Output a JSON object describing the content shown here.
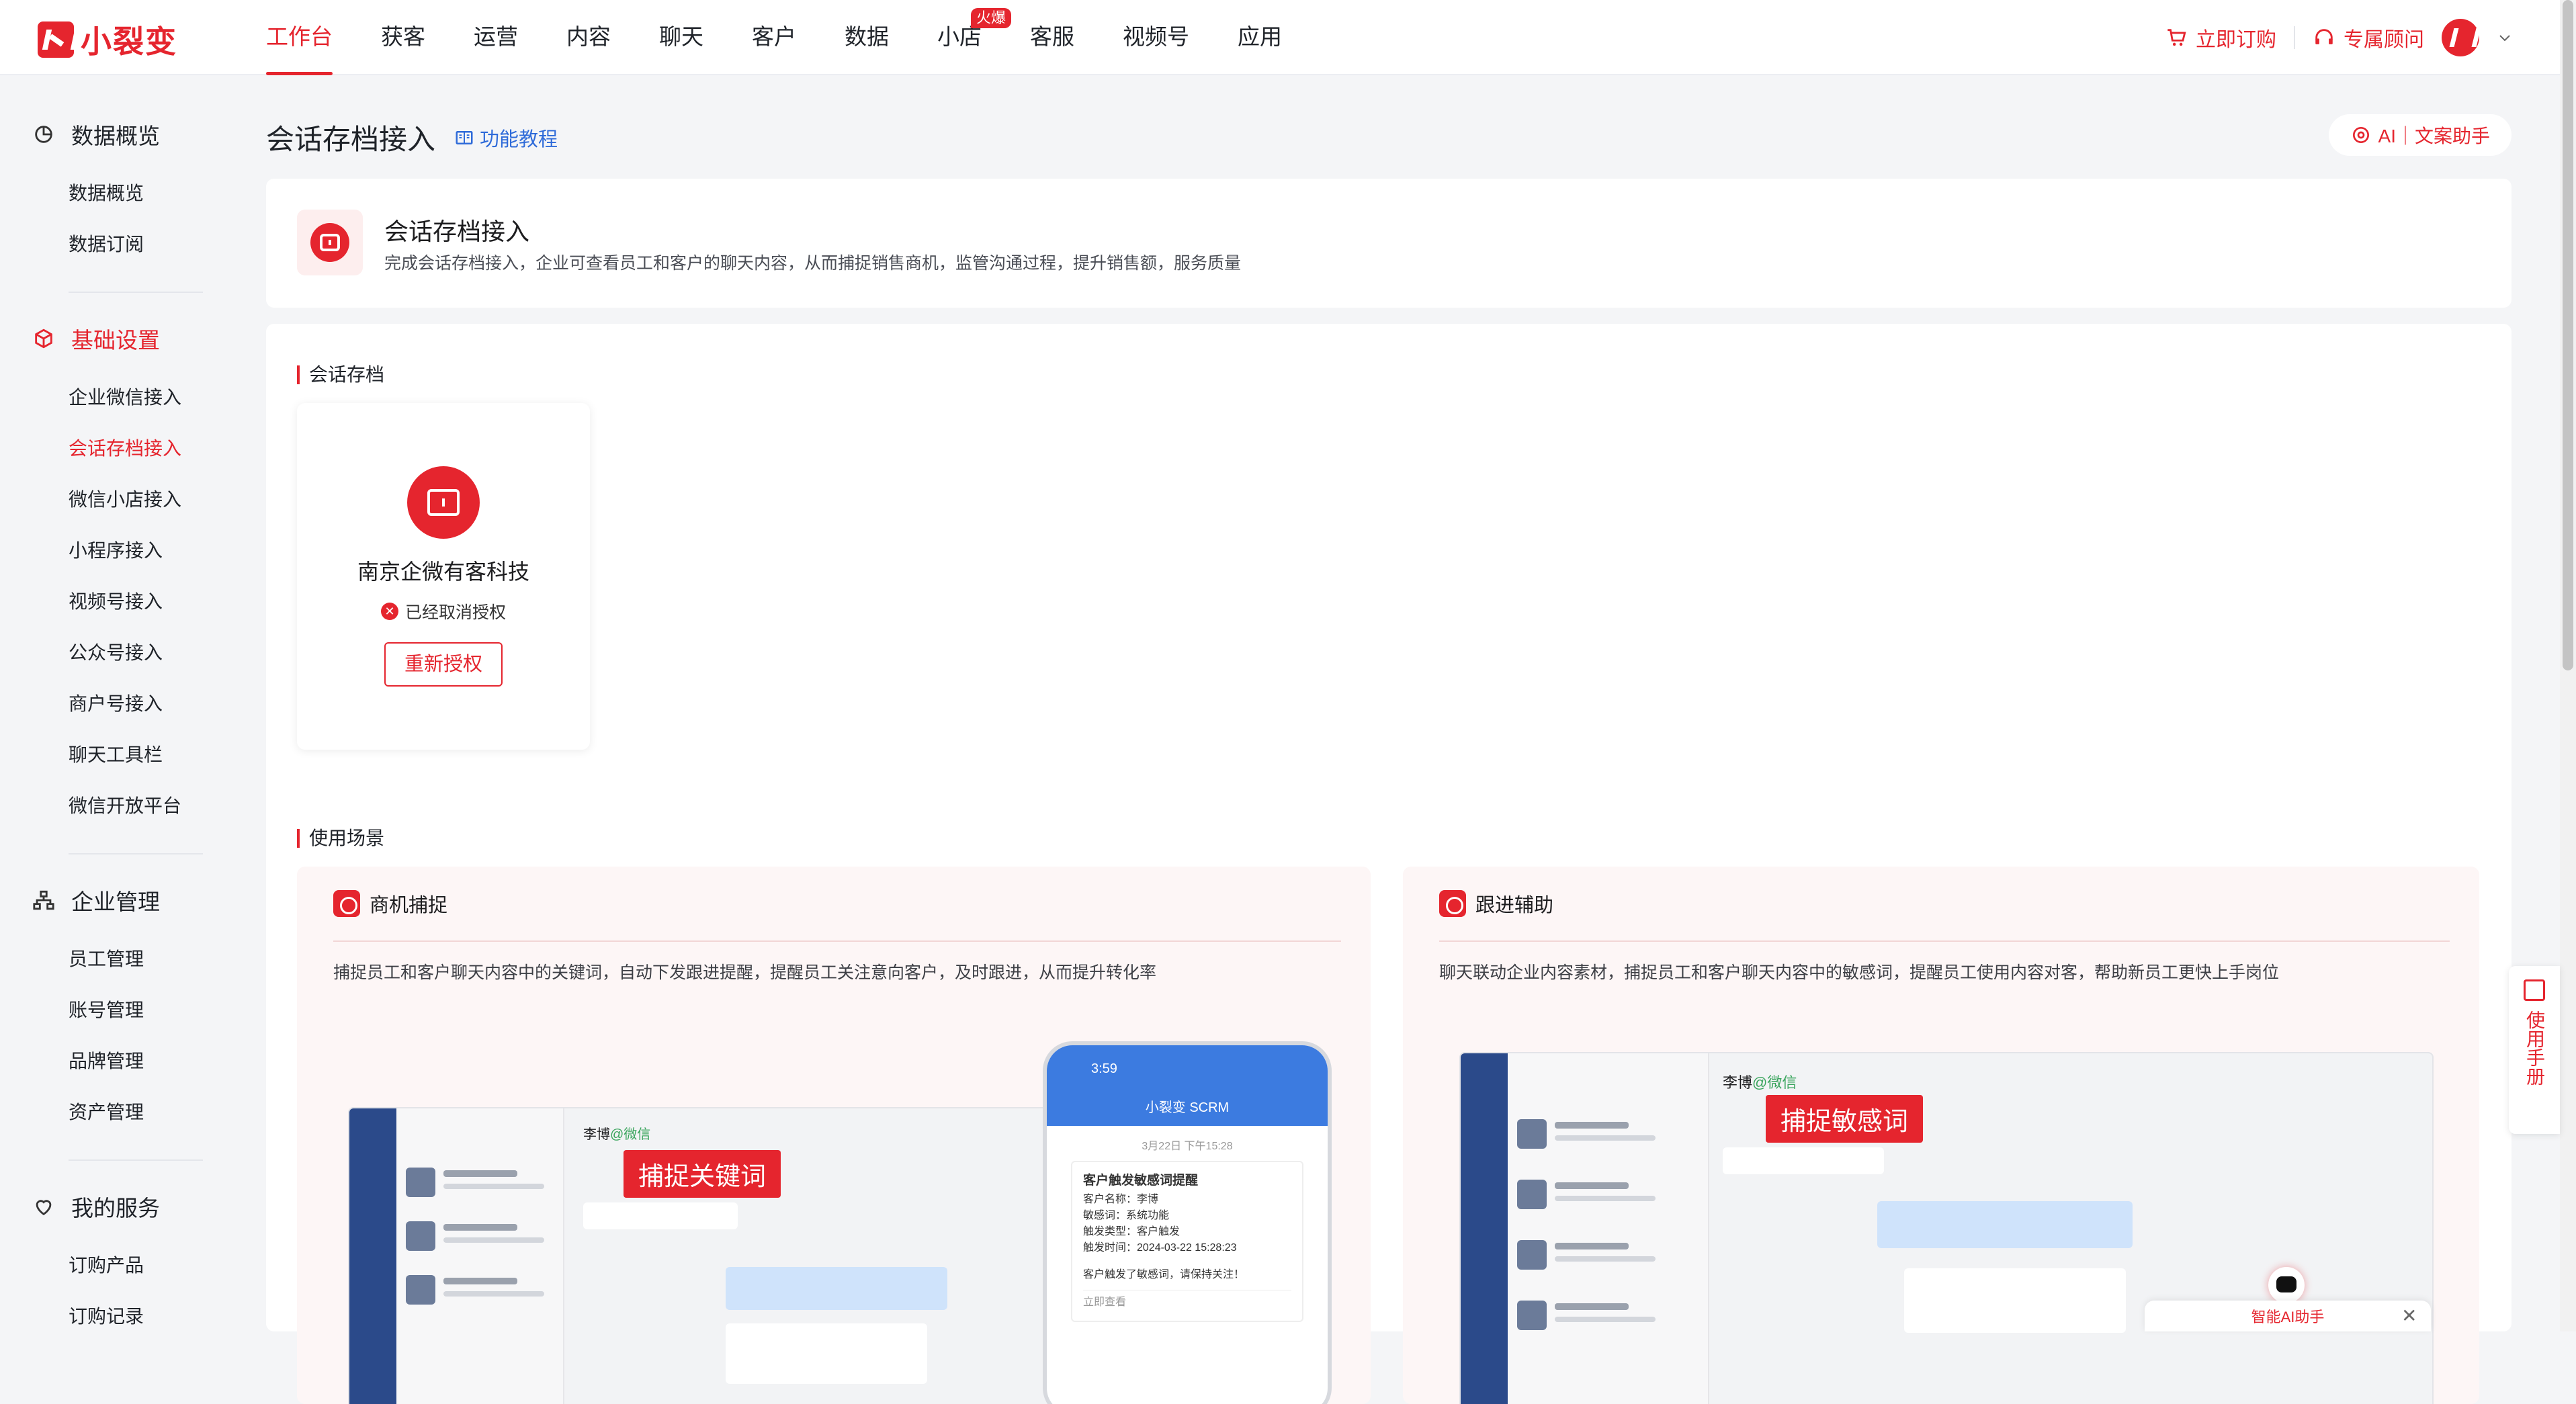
{
  "brand": {
    "logo_text": "小裂变"
  },
  "nav": {
    "items": [
      "工作台",
      "获客",
      "运营",
      "内容",
      "聊天",
      "客户",
      "数据",
      "小店",
      "客服",
      "视频号",
      "应用"
    ],
    "active": "工作台",
    "hot_badge": "火爆"
  },
  "top_right": {
    "buy": "立即订购",
    "advisor": "专属顾问"
  },
  "sidebar": {
    "groups": [
      {
        "title": "数据概览",
        "icon": "chart-icon",
        "items": [
          "数据概览",
          "数据订阅"
        ]
      },
      {
        "title": "基础设置",
        "icon": "cube-icon",
        "items": [
          "企业微信接入",
          "会话存档接入",
          "微信小店接入",
          "小程序接入",
          "视频号接入",
          "公众号接入",
          "商户号接入",
          "聊天工具栏",
          "微信开放平台"
        ]
      },
      {
        "title": "企业管理",
        "icon": "org-icon",
        "items": [
          "员工管理",
          "账号管理",
          "品牌管理",
          "资产管理"
        ]
      },
      {
        "title": "我的服务",
        "icon": "heart-icon",
        "items": [
          "订购产品",
          "订购记录"
        ]
      }
    ],
    "active_group": "基础设置",
    "active_item": "会话存档接入"
  },
  "page": {
    "title": "会话存档接入",
    "tutorial": "功能教程",
    "ai_assistant": "AI｜文案助手"
  },
  "intro": {
    "title": "会话存档接入",
    "desc": "完成会话存档接入，企业可查看员工和客户的聊天内容，从而捕捉销售商机，监管沟通过程，提升销售额，服务质量"
  },
  "archive": {
    "section_label": "会话存档",
    "company": "南京企微有客科技",
    "status": "已经取消授权",
    "reauth_button": "重新授权"
  },
  "scenarios": {
    "section_label": "使用场景",
    "items": [
      {
        "title": "商机捕捉",
        "desc": "捕捉员工和客户聊天内容中的关键词，自动下发跟进提醒，提醒员工关注意向客户，及时跟进，从而提升转化率",
        "tag": "捕捉关键词",
        "chat_name": "李博",
        "chat_suffix": "@微信"
      },
      {
        "title": "跟进辅助",
        "desc": "聊天联动企业内容素材，捕捉员工和客户聊天内容中的敏感词，提醒员工使用内容对客，帮助新员工更快上手岗位",
        "tag": "捕捉敏感词",
        "chat_name": "李博",
        "chat_suffix": "@微信"
      }
    ]
  },
  "phone": {
    "time": "3:59",
    "title": "小裂变 SCRM",
    "date": "3月22日 下午15:28",
    "card_title": "客户触发敏感词提醒",
    "lines": [
      "客户名称：李博",
      "敏感词：系统功能",
      "触发类型：客户触发",
      "触发时间：2024-03-22 15:28:23",
      "",
      "客户触发了敏感词，请保持关注！"
    ],
    "link": "立即查看"
  },
  "float_manual": {
    "label": "使用手册"
  },
  "ai_widget": {
    "label": "智能AI助手"
  },
  "colors": {
    "brand": "#e5252e",
    "link": "#2f6bd9",
    "page_bg": "#f4f5f7"
  }
}
